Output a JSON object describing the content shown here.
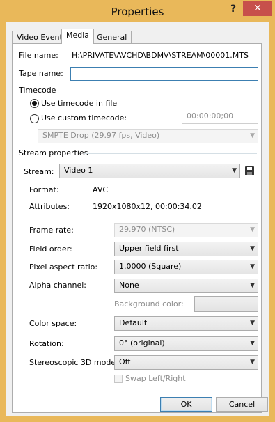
{
  "window": {
    "title": "Properties",
    "help_glyph": "?",
    "close_glyph": "✕"
  },
  "tabs": [
    {
      "label": "Video Event",
      "active": false
    },
    {
      "label": "Media",
      "active": true
    },
    {
      "label": "General",
      "active": false
    }
  ],
  "media": {
    "file_name_label": "File name:",
    "file_name_value": "H:\\PRIVATE\\AVCHD\\BDMV\\STREAM\\00001.MTS",
    "tape_name_label": "Tape name:",
    "tape_name_value": "",
    "timecode_group": "Timecode",
    "use_timecode_in_file": "Use timecode in file",
    "use_custom_timecode": "Use custom timecode:",
    "timecode_selected": "use_timecode_in_file",
    "custom_timecode_value": "00:00:00;00",
    "timecode_format": "SMPTE Drop (29.97 fps, Video)",
    "stream_group": "Stream properties",
    "stream_label": "Stream:",
    "stream_value": "Video 1",
    "format_label": "Format:",
    "format_value": "AVC",
    "attributes_label": "Attributes:",
    "attributes_value": "1920x1080x12, 00:00:34.02",
    "frame_rate_label": "Frame rate:",
    "frame_rate_value": "29.970 (NTSC)",
    "field_order_label": "Field order:",
    "field_order_value": "Upper field first",
    "pixel_aspect_label": "Pixel aspect ratio:",
    "pixel_aspect_value": "1.0000 (Square)",
    "alpha_label": "Alpha channel:",
    "alpha_value": "None",
    "background_color_label": "Background color:",
    "color_space_label": "Color space:",
    "color_space_value": "Default",
    "rotation_label": "Rotation:",
    "rotation_value": "0° (original)",
    "stereo_label": "Stereoscopic 3D mode:",
    "stereo_value": "Off",
    "swap_label": "Swap Left/Right",
    "swap_checked": false
  },
  "buttons": {
    "ok": "OK",
    "cancel": "Cancel"
  },
  "icons": {
    "save": "save-icon",
    "dropdown": "chevron-down-icon"
  },
  "colors": {
    "window_frame": "#e9b85a",
    "close_button": "#c7504b",
    "focus_border": "#3c7fb1"
  }
}
